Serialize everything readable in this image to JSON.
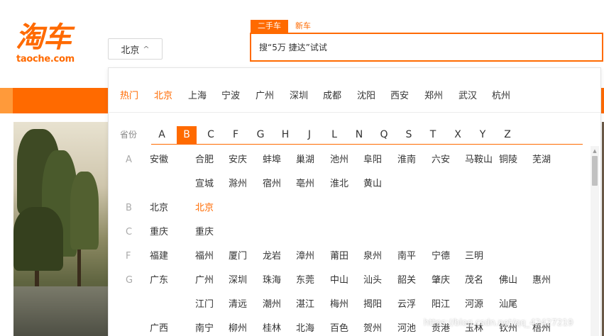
{
  "logo": {
    "cn": "淘车",
    "en": "taoche.com"
  },
  "city_button": {
    "label": "北京",
    "caret": "^"
  },
  "search": {
    "tabs": [
      {
        "label": "二手车",
        "active": true
      },
      {
        "label": "新车",
        "active": false
      }
    ],
    "placeholder": "搜“5万 捷达”试试"
  },
  "city_panel": {
    "hot_label": "热门",
    "hot_cities": [
      "北京",
      "上海",
      "宁波",
      "广州",
      "深圳",
      "成都",
      "沈阳",
      "西安",
      "郑州",
      "武汉",
      "杭州"
    ],
    "selected_city": "北京",
    "province_label": "省份",
    "letters": [
      "A",
      "B",
      "C",
      "F",
      "G",
      "H",
      "J",
      "L",
      "N",
      "Q",
      "S",
      "T",
      "X",
      "Y",
      "Z"
    ],
    "active_letter": "B",
    "groups": [
      {
        "letter": "A",
        "province": "安徽",
        "lines": [
          [
            "合肥",
            "安庆",
            "蚌埠",
            "巢湖",
            "池州",
            "阜阳",
            "淮南",
            "六安",
            "马鞍山",
            "铜陵",
            "芜湖"
          ],
          [
            "宣城",
            "滁州",
            "宿州",
            "亳州",
            "淮北",
            "黄山"
          ]
        ]
      },
      {
        "letter": "B",
        "province": "北京",
        "lines": [
          [
            "北京"
          ]
        ]
      },
      {
        "letter": "C",
        "province": "重庆",
        "lines": [
          [
            "重庆"
          ]
        ]
      },
      {
        "letter": "F",
        "province": "福建",
        "lines": [
          [
            "福州",
            "厦门",
            "龙岩",
            "漳州",
            "莆田",
            "泉州",
            "南平",
            "宁德",
            "三明"
          ]
        ]
      },
      {
        "letter": "G",
        "province": "广东",
        "lines": [
          [
            "广州",
            "深圳",
            "珠海",
            "东莞",
            "中山",
            "汕头",
            "韶关",
            "肇庆",
            "茂名",
            "佛山",
            "惠州"
          ],
          [
            "江门",
            "清远",
            "潮州",
            "湛江",
            "梅州",
            "揭阳",
            "云浮",
            "阳江",
            "河源",
            "汕尾"
          ]
        ]
      },
      {
        "letter": "",
        "province": "广西",
        "lines": [
          [
            "南宁",
            "柳州",
            "桂林",
            "北海",
            "百色",
            "贺州",
            "河池",
            "贵港",
            "玉林",
            "钦州",
            "梧州"
          ]
        ]
      }
    ]
  },
  "watermark": "https://blog.csdn.net/qq_42427219",
  "colors": {
    "accent": "#ff6a00"
  }
}
